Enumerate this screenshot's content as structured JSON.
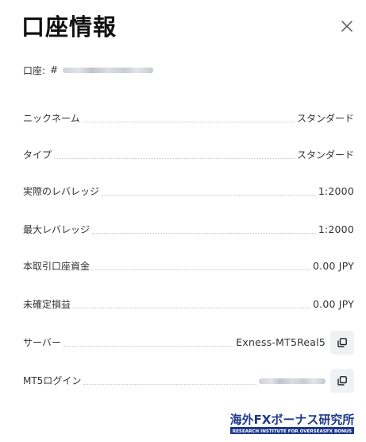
{
  "dialog": {
    "title": "口座情報",
    "close_icon": "close-icon"
  },
  "account": {
    "label": "口座:",
    "hash": "#"
  },
  "rows": [
    {
      "label": "ニックネーム",
      "value": "スタンダード"
    },
    {
      "label": "タイプ",
      "value": "スタンダード"
    },
    {
      "label": "実際のレバレッジ",
      "value": "1:2000"
    },
    {
      "label": "最大レバレッジ",
      "value": "1:2000"
    },
    {
      "label": "本取引口座資金",
      "value": "0.00 JPY"
    },
    {
      "label": "未確定損益",
      "value": "0.00 JPY"
    },
    {
      "label": "サーバー",
      "value": "Exness-MT5Real5",
      "copy_icon": "copy-icon"
    },
    {
      "label": "MT5ログイン",
      "value": "",
      "copy_icon": "copy-icon"
    }
  ],
  "watermark": {
    "text": "海外FXボーナス研究所",
    "subtext": "RESEARCH INSTITUTE FOR OVERSEASFX BONUS"
  },
  "colors": {
    "text": "#333333",
    "title": "#111111",
    "copy_bg": "#f0f1f3",
    "watermark_blue": "#1f3a8a"
  }
}
